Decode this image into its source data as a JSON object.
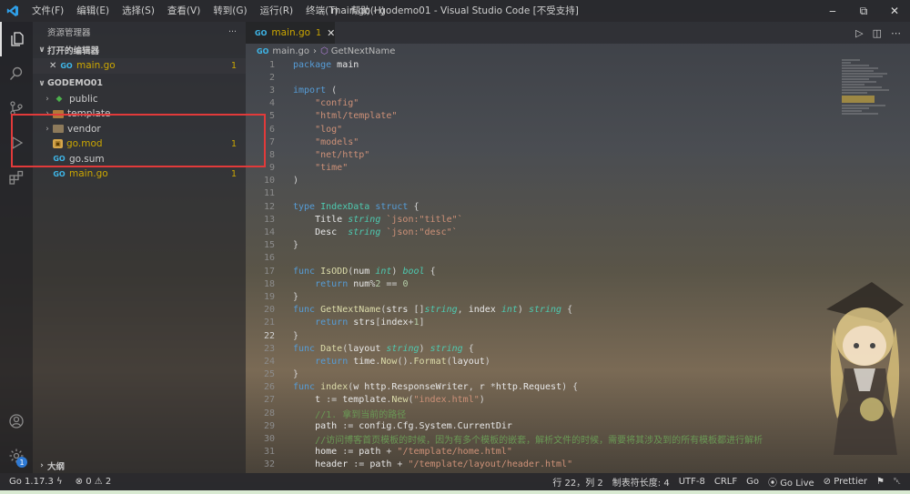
{
  "titlebar": {
    "menus": [
      "文件(F)",
      "编辑(E)",
      "选择(S)",
      "查看(V)",
      "转到(G)",
      "运行(R)",
      "终端(T)",
      "帮助(H)"
    ],
    "title": "main.go - godemo01 - Visual Studio Code [不受支持]"
  },
  "activity": {
    "settings_badge": "1"
  },
  "sidebar": {
    "header": "资源管理器",
    "more": "···",
    "open_editors": {
      "label": "打开的编辑器",
      "items": [
        {
          "name": "main.go",
          "count": "1"
        }
      ]
    },
    "project": {
      "label": "GODEMO01",
      "items": [
        {
          "name": "public",
          "type": "folder"
        },
        {
          "name": "template",
          "type": "folder"
        },
        {
          "name": "vendor",
          "type": "folder"
        },
        {
          "name": "go.mod",
          "type": "mod",
          "count": "1"
        },
        {
          "name": "go.sum",
          "type": "go"
        },
        {
          "name": "main.go",
          "type": "go",
          "count": "1"
        }
      ]
    },
    "outline": "大纲"
  },
  "editor": {
    "tab": {
      "label": "main.go",
      "count": "1"
    },
    "breadcrumb": {
      "file": "main.go",
      "symbol": "GetNextName"
    },
    "lines": [
      {
        "n": "1",
        "t": [
          [
            "kw",
            "package "
          ],
          [
            "id",
            "main"
          ]
        ]
      },
      {
        "n": "2",
        "t": []
      },
      {
        "n": "3",
        "t": [
          [
            "kw",
            "import "
          ],
          [
            "op",
            "("
          ]
        ]
      },
      {
        "n": "4",
        "t": [
          [
            "op",
            "    "
          ],
          [
            "str",
            "\"config\""
          ]
        ]
      },
      {
        "n": "5",
        "t": [
          [
            "op",
            "    "
          ],
          [
            "str",
            "\"html/template\""
          ]
        ]
      },
      {
        "n": "6",
        "t": [
          [
            "op",
            "    "
          ],
          [
            "str",
            "\"log\""
          ]
        ]
      },
      {
        "n": "7",
        "t": [
          [
            "op",
            "    "
          ],
          [
            "str",
            "\"models\""
          ]
        ]
      },
      {
        "n": "8",
        "t": [
          [
            "op",
            "    "
          ],
          [
            "str",
            "\"net/http\""
          ]
        ]
      },
      {
        "n": "9",
        "t": [
          [
            "op",
            "    "
          ],
          [
            "str",
            "\"time\""
          ]
        ]
      },
      {
        "n": "10",
        "t": [
          [
            "op",
            ")"
          ]
        ]
      },
      {
        "n": "11",
        "t": []
      },
      {
        "n": "12",
        "t": [
          [
            "kw",
            "type "
          ],
          [
            "ty",
            "IndexData "
          ],
          [
            "kw",
            "struct "
          ],
          [
            "op",
            "{"
          ]
        ]
      },
      {
        "n": "13",
        "t": [
          [
            "op",
            "    "
          ],
          [
            "id",
            "Title "
          ],
          [
            "it",
            "string "
          ],
          [
            "str",
            "`json:\"title\"`"
          ]
        ]
      },
      {
        "n": "14",
        "t": [
          [
            "op",
            "    "
          ],
          [
            "id",
            "Desc  "
          ],
          [
            "it",
            "string "
          ],
          [
            "str",
            "`json:\"desc\"`"
          ]
        ]
      },
      {
        "n": "15",
        "t": [
          [
            "op",
            "}"
          ]
        ]
      },
      {
        "n": "16",
        "t": []
      },
      {
        "n": "17",
        "t": [
          [
            "kw",
            "func "
          ],
          [
            "fn",
            "IsODD"
          ],
          [
            "op",
            "("
          ],
          [
            "id",
            "num "
          ],
          [
            "it",
            "int"
          ],
          [
            "op",
            ") "
          ],
          [
            "it",
            "bool "
          ],
          [
            "op",
            "{"
          ]
        ]
      },
      {
        "n": "18",
        "t": [
          [
            "op",
            "    "
          ],
          [
            "kw",
            "return "
          ],
          [
            "id",
            "num"
          ],
          [
            "op",
            "%"
          ],
          [
            "num",
            "2"
          ],
          [
            "op",
            " == "
          ],
          [
            "num",
            "0"
          ]
        ]
      },
      {
        "n": "19",
        "t": [
          [
            "op",
            "}"
          ]
        ]
      },
      {
        "n": "20",
        "t": [
          [
            "kw",
            "func "
          ],
          [
            "fn",
            "GetNextName"
          ],
          [
            "op",
            "("
          ],
          [
            "id",
            "strs "
          ],
          [
            "op",
            "[]"
          ],
          [
            "it",
            "string"
          ],
          [
            "op",
            ", "
          ],
          [
            "id",
            "index "
          ],
          [
            "it",
            "int"
          ],
          [
            "op",
            ") "
          ],
          [
            "it",
            "string "
          ],
          [
            "op",
            "{"
          ]
        ]
      },
      {
        "n": "21",
        "t": [
          [
            "op",
            "    "
          ],
          [
            "kw",
            "return "
          ],
          [
            "id",
            "strs"
          ],
          [
            "op",
            "["
          ],
          [
            "id",
            "index"
          ],
          [
            "op",
            "+"
          ],
          [
            "num",
            "1"
          ],
          [
            "op",
            "]"
          ]
        ]
      },
      {
        "n": "22",
        "t": [
          [
            "op",
            "}"
          ]
        ],
        "cur": true
      },
      {
        "n": "23",
        "t": [
          [
            "kw",
            "func "
          ],
          [
            "fn",
            "Date"
          ],
          [
            "op",
            "("
          ],
          [
            "id",
            "layout "
          ],
          [
            "it",
            "string"
          ],
          [
            "op",
            ") "
          ],
          [
            "it",
            "string "
          ],
          [
            "op",
            "{"
          ]
        ]
      },
      {
        "n": "24",
        "t": [
          [
            "op",
            "    "
          ],
          [
            "kw",
            "return "
          ],
          [
            "id",
            "time"
          ],
          [
            "op",
            "."
          ],
          [
            "fn",
            "Now"
          ],
          [
            "op",
            "()."
          ],
          [
            "fn",
            "Format"
          ],
          [
            "op",
            "("
          ],
          [
            "id",
            "layout"
          ],
          [
            "op",
            ")"
          ]
        ]
      },
      {
        "n": "25",
        "t": [
          [
            "op",
            "}"
          ]
        ]
      },
      {
        "n": "26",
        "t": [
          [
            "kw",
            "func "
          ],
          [
            "fn",
            "index"
          ],
          [
            "op",
            "("
          ],
          [
            "id",
            "w http"
          ],
          [
            "op",
            "."
          ],
          [
            "id",
            "ResponseWriter"
          ],
          [
            "op",
            ", "
          ],
          [
            "id",
            "r "
          ],
          [
            "op",
            "*"
          ],
          [
            "id",
            "http"
          ],
          [
            "op",
            "."
          ],
          [
            "id",
            "Request"
          ],
          [
            "op",
            ") {"
          ]
        ]
      },
      {
        "n": "27",
        "t": [
          [
            "op",
            "    "
          ],
          [
            "id",
            "t "
          ],
          [
            "op",
            ":= "
          ],
          [
            "id",
            "template"
          ],
          [
            "op",
            "."
          ],
          [
            "fn",
            "New"
          ],
          [
            "op",
            "("
          ],
          [
            "str",
            "\"index.html\""
          ],
          [
            "op",
            ")"
          ]
        ]
      },
      {
        "n": "28",
        "t": [
          [
            "op",
            "    "
          ],
          [
            "cm",
            "//1. 拿到当前的路径"
          ]
        ]
      },
      {
        "n": "29",
        "t": [
          [
            "op",
            "    "
          ],
          [
            "id",
            "path "
          ],
          [
            "op",
            ":= "
          ],
          [
            "id",
            "config"
          ],
          [
            "op",
            "."
          ],
          [
            "id",
            "Cfg"
          ],
          [
            "op",
            "."
          ],
          [
            "id",
            "System"
          ],
          [
            "op",
            "."
          ],
          [
            "id",
            "CurrentDir"
          ]
        ]
      },
      {
        "n": "30",
        "t": [
          [
            "op",
            "    "
          ],
          [
            "cm",
            "//访问博客首页模板的时候，因为有多个模板的嵌套，解析文件的时候，需要将其涉及到的所有模板都进行解析"
          ]
        ]
      },
      {
        "n": "31",
        "t": [
          [
            "op",
            "    "
          ],
          [
            "id",
            "home "
          ],
          [
            "op",
            ":= "
          ],
          [
            "id",
            "path "
          ],
          [
            "op",
            "+ "
          ],
          [
            "str",
            "\"/template/home.html\""
          ]
        ]
      },
      {
        "n": "32",
        "t": [
          [
            "op",
            "    "
          ],
          [
            "id",
            "header "
          ],
          [
            "op",
            ":= "
          ],
          [
            "id",
            "path "
          ],
          [
            "op",
            "+ "
          ],
          [
            "str",
            "\"/template/layout/header.html\""
          ]
        ]
      }
    ]
  },
  "statusbar": {
    "go_version": "Go 1.17.3",
    "problems": "⊗ 0 ⚠ 2",
    "position": "行 22，列 2",
    "tab_size": "制表符长度: 4",
    "encoding": "UTF-8",
    "eol": "CRLF",
    "language": "Go",
    "go_live": "Go Live",
    "prettier": "Prettier"
  }
}
